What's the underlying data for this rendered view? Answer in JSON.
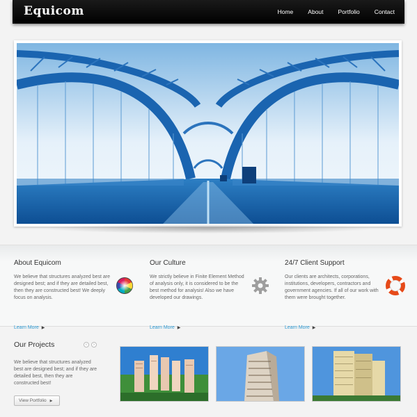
{
  "brand": {
    "name": "Equicom"
  },
  "nav": {
    "items": [
      "Home",
      "About",
      "Portfolio",
      "Contact"
    ]
  },
  "hero": {
    "icon": "bridge-photo"
  },
  "features": [
    {
      "title": "About Equicom",
      "text": "We believe that structures analyzed best are designed best; and if they are detailed best, then they are constructed best! We deeply focus on analysis.",
      "more": "Learn More",
      "icon": "color-wheel-icon"
    },
    {
      "title": "Our Culture",
      "text": "We strictly believe in Finite Element Method of analysis only, it is considered to be the best method for analysis! Also we have developed our drawings.",
      "more": "Learn More",
      "icon": "gear-icon"
    },
    {
      "title": "24/7 Client Support",
      "text": "Our clients are architects, corporations, institutions, developers, contractors and government agencies. If all of our work with them were brought together.",
      "more": "Learn More",
      "icon": "lifebuoy-icon"
    }
  ],
  "projects": {
    "title": "Our Projects",
    "text": "We believe that structures analyzed best are designed best; and if they are detailed best, then they are constructed best!",
    "button": "View Portfolio",
    "pager_prev": "‹",
    "pager_next": "›"
  },
  "colors": {
    "accent": "#2d9ad3",
    "navbar": "#000000",
    "hero_blue": "#1a6fb5"
  }
}
